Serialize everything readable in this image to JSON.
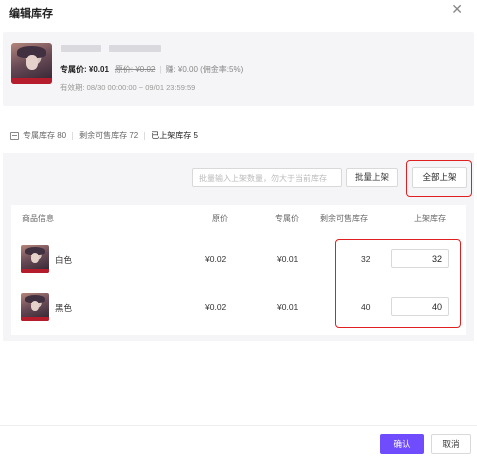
{
  "dialog": {
    "title": "编辑库存",
    "close_icon": "close-icon"
  },
  "product": {
    "exclusive_price": "专属价: ¥0.01",
    "original_price": "原价: ¥0.02",
    "earn": "赚: ¥0.00 (佣金率:5%)",
    "valid_period": "有效期: 08/30 00:00:00 ~ 09/01 23:59:59"
  },
  "stock_tabs": {
    "icon": "box-icon",
    "exclusive": "专属库存 80",
    "remaining": "剩余可售库存 72",
    "listed": "已上架库存 5"
  },
  "batch": {
    "placeholder": "批量输入上架数量，勿大于当前库存",
    "batch_button": "批量上架",
    "all_button": "全部上架"
  },
  "table": {
    "headers": [
      "商品信息",
      "原价",
      "专属价",
      "剩余可售库存",
      "上架库存"
    ],
    "rows": [
      {
        "name": "白色",
        "original": "¥0.02",
        "exclusive": "¥0.01",
        "remaining": "32",
        "listed": "32"
      },
      {
        "name": "黑色",
        "original": "¥0.02",
        "exclusive": "¥0.01",
        "remaining": "40",
        "listed": "40"
      }
    ]
  },
  "footer": {
    "confirm": "确认",
    "cancel": "取消"
  },
  "colors": {
    "primary": "#6f4dfe",
    "highlight": "#e02020"
  }
}
